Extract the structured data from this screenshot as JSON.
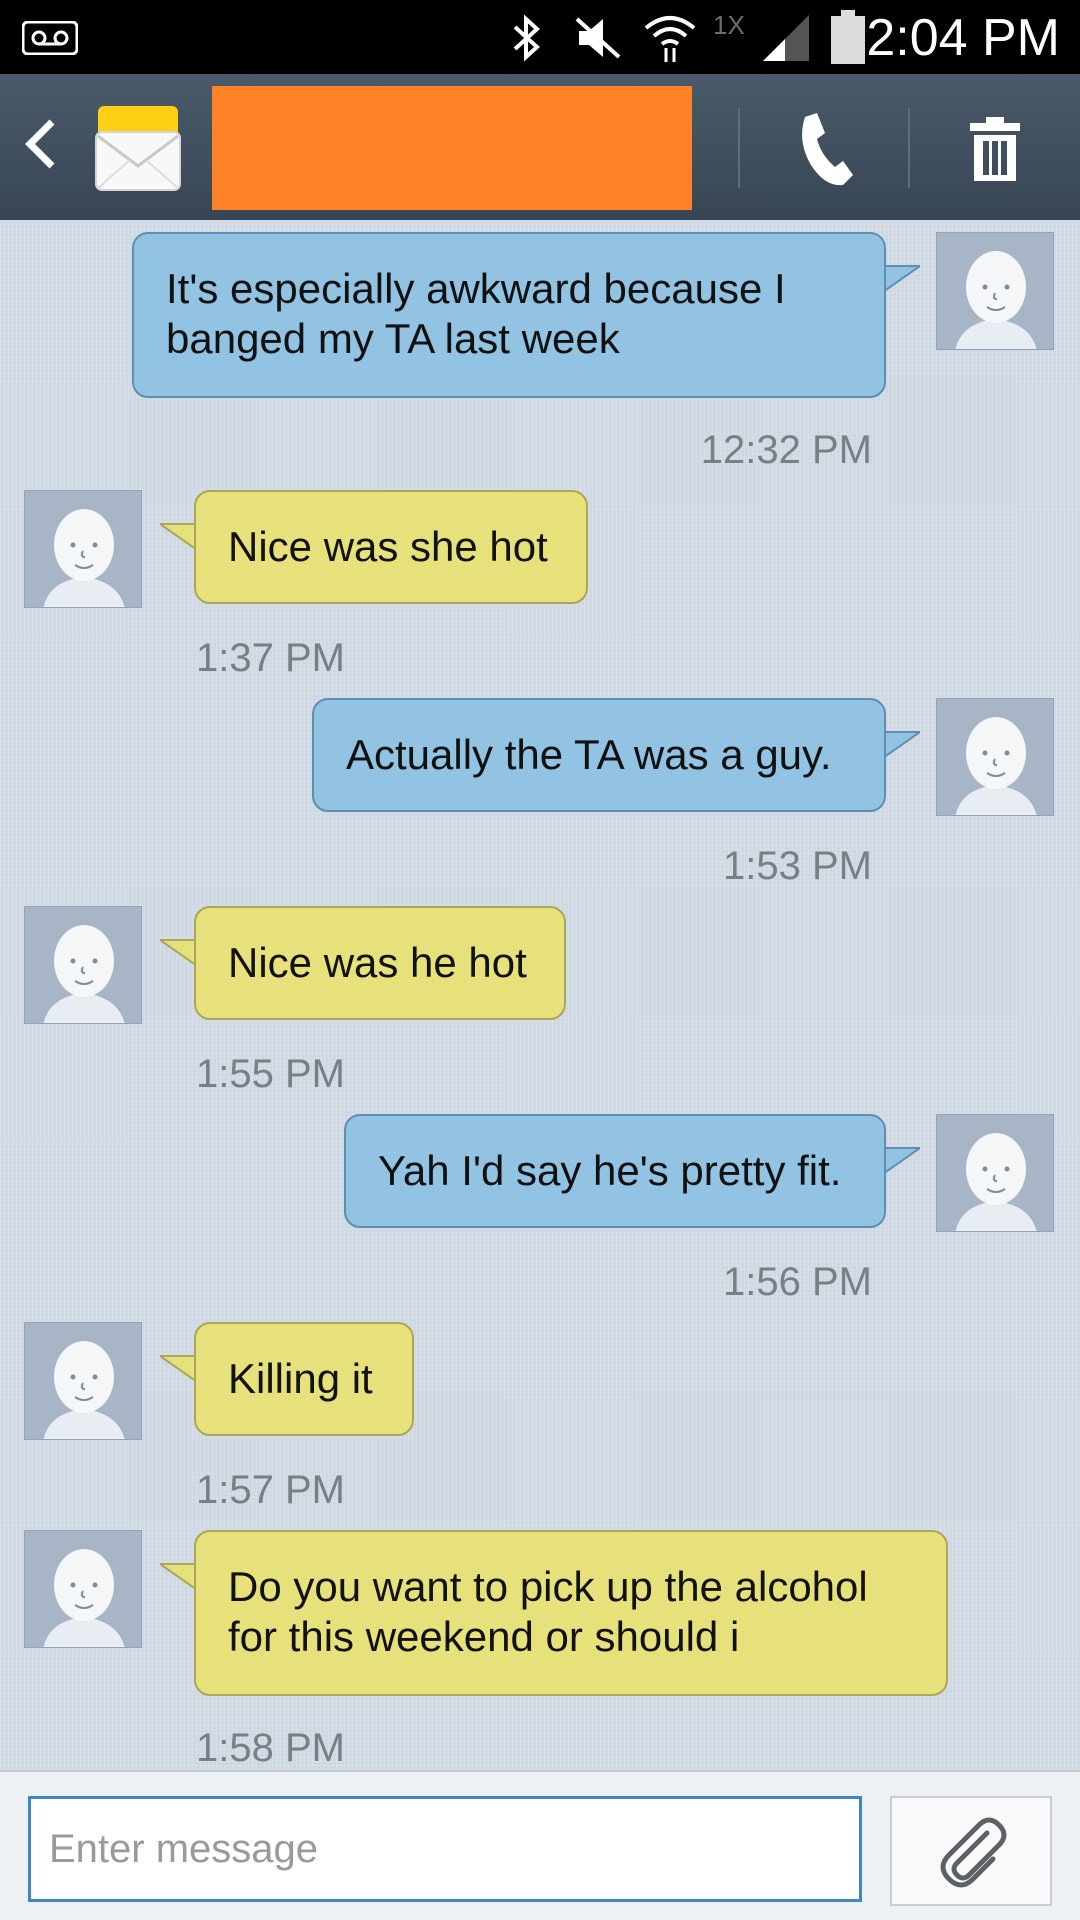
{
  "status_bar": {
    "time": "2:04 PM",
    "network_label": "1X",
    "icons": [
      "voicemail-icon",
      "bluetooth-icon",
      "mute-icon",
      "wifi-icon",
      "signal-icon",
      "battery-icon"
    ]
  },
  "header": {
    "contact_name": "",
    "icons": [
      "back-icon",
      "messaging-app-icon",
      "call-icon",
      "delete-icon"
    ]
  },
  "conversation": {
    "messages": [
      {
        "direction": "sent",
        "text": "It's especially awkward because I banged my TA last week",
        "time": "12:32 PM"
      },
      {
        "direction": "received",
        "text": "Nice was she hot",
        "time": "1:37 PM"
      },
      {
        "direction": "sent",
        "text": "Actually the TA was a guy.",
        "time": "1:53 PM"
      },
      {
        "direction": "received",
        "text": "Nice was he hot",
        "time": "1:55 PM"
      },
      {
        "direction": "sent",
        "text": "Yah I'd say he's pretty fit.",
        "time": "1:56 PM"
      },
      {
        "direction": "received",
        "text": "Killing it",
        "time": "1:57 PM"
      },
      {
        "direction": "received",
        "text": "Do you want to pick up the alcohol for this weekend or should i",
        "time": "1:58 PM"
      }
    ]
  },
  "composer": {
    "placeholder": "Enter message",
    "value": "",
    "attach_icon": "paperclip-icon"
  },
  "colors": {
    "sent_bubble": "#92c3e3",
    "received_bubble": "#e6e17a",
    "header_bg": "#3e4d5b",
    "redaction": "#ff8326",
    "input_border": "#3f86c6"
  }
}
